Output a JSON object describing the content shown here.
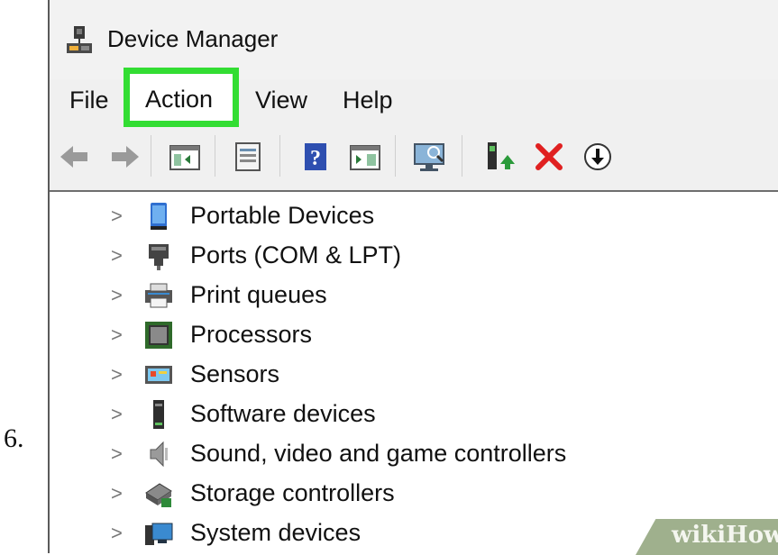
{
  "step": {
    "number": "6."
  },
  "window": {
    "title": "Device Manager"
  },
  "menu": {
    "items": [
      {
        "label": "File"
      },
      {
        "label": "Action"
      },
      {
        "label": "View"
      },
      {
        "label": "Help"
      }
    ],
    "highlight_color": "#33dd33"
  },
  "toolbar": {
    "buttons": [
      "back-arrow-icon",
      "forward-arrow-icon",
      "show-hide-console-tree-icon",
      "properties-icon",
      "help-icon",
      "show-action-pane-icon",
      "scan-hardware-icon",
      "update-driver-icon",
      "uninstall-icon",
      "download-icon"
    ]
  },
  "tree": {
    "items": [
      {
        "label": "Portable Devices",
        "icon": "portable-devices-icon"
      },
      {
        "label": "Ports (COM & LPT)",
        "icon": "ports-icon"
      },
      {
        "label": "Print queues",
        "icon": "printer-icon"
      },
      {
        "label": "Processors",
        "icon": "processor-icon"
      },
      {
        "label": "Sensors",
        "icon": "sensors-icon"
      },
      {
        "label": "Software devices",
        "icon": "software-devices-icon"
      },
      {
        "label": "Sound, video and game controllers",
        "icon": "speaker-icon"
      },
      {
        "label": "Storage controllers",
        "icon": "storage-controller-icon"
      },
      {
        "label": "System devices",
        "icon": "system-devices-icon"
      }
    ]
  },
  "watermark": {
    "text": "wikiHow"
  }
}
